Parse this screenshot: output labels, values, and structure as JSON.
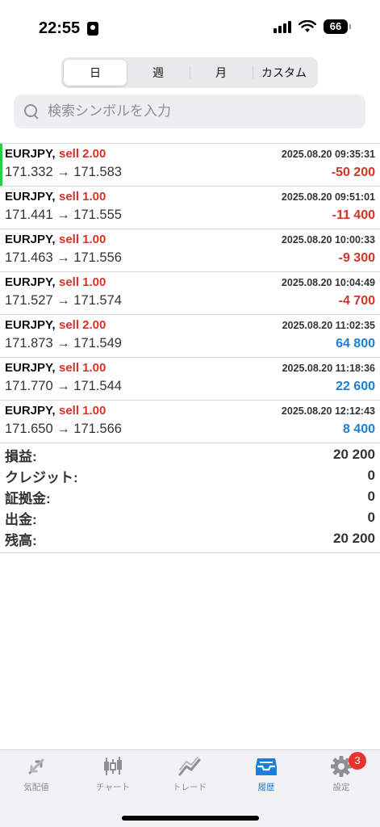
{
  "status_bar": {
    "time": "22:55",
    "battery": "66"
  },
  "segments": [
    "日",
    "週",
    "月",
    "カスタム"
  ],
  "search": {
    "placeholder": "検索シンボルを入力"
  },
  "trades": [
    {
      "symbol": "EURJPY,",
      "side": "sell 2.00",
      "time": "2025.08.20 09:35:31",
      "prices": "171.332 → 171.583",
      "profit": "-50 200"
    },
    {
      "symbol": "EURJPY,",
      "side": "sell 1.00",
      "time": "2025.08.20 09:51:01",
      "prices": "171.441 → 171.555",
      "profit": "-11 400"
    },
    {
      "symbol": "EURJPY,",
      "side": "sell 1.00",
      "time": "2025.08.20 10:00:33",
      "prices": "171.463 → 171.556",
      "profit": "-9 300"
    },
    {
      "symbol": "EURJPY,",
      "side": "sell 1.00",
      "time": "2025.08.20 10:04:49",
      "prices": "171.527 → 171.574",
      "profit": "-4 700"
    },
    {
      "symbol": "EURJPY,",
      "side": "sell 2.00",
      "time": "2025.08.20 11:02:35",
      "prices": "171.873 → 171.549",
      "profit": "64 800"
    },
    {
      "symbol": "EURJPY,",
      "side": "sell 1.00",
      "time": "2025.08.20 11:18:36",
      "prices": "171.770 → 171.544",
      "profit": "22 600"
    },
    {
      "symbol": "EURJPY,",
      "side": "sell 1.00",
      "time": "2025.08.20 12:12:43",
      "prices": "171.650 → 171.566",
      "profit": "8 400"
    }
  ],
  "summary": [
    {
      "label": "損益:",
      "value": "20 200"
    },
    {
      "label": "クレジット:",
      "value": "0"
    },
    {
      "label": "証拠金:",
      "value": "0"
    },
    {
      "label": "出金:",
      "value": "0"
    },
    {
      "label": "残高:",
      "value": "20 200"
    }
  ],
  "tabs": [
    {
      "label": "気配値",
      "icon": "quotes-icon"
    },
    {
      "label": "チャート",
      "icon": "chart-candles-icon"
    },
    {
      "label": "トレード",
      "icon": "trade-icon"
    },
    {
      "label": "履歴",
      "icon": "history-inbox-icon"
    },
    {
      "label": "設定",
      "icon": "gear-icon"
    }
  ],
  "settings_badge": "3",
  "colors": {
    "loss": "#d63228",
    "profit": "#1a7fd6",
    "active_tab": "#1a7fd6",
    "selected_marker": "#2ecc40"
  }
}
